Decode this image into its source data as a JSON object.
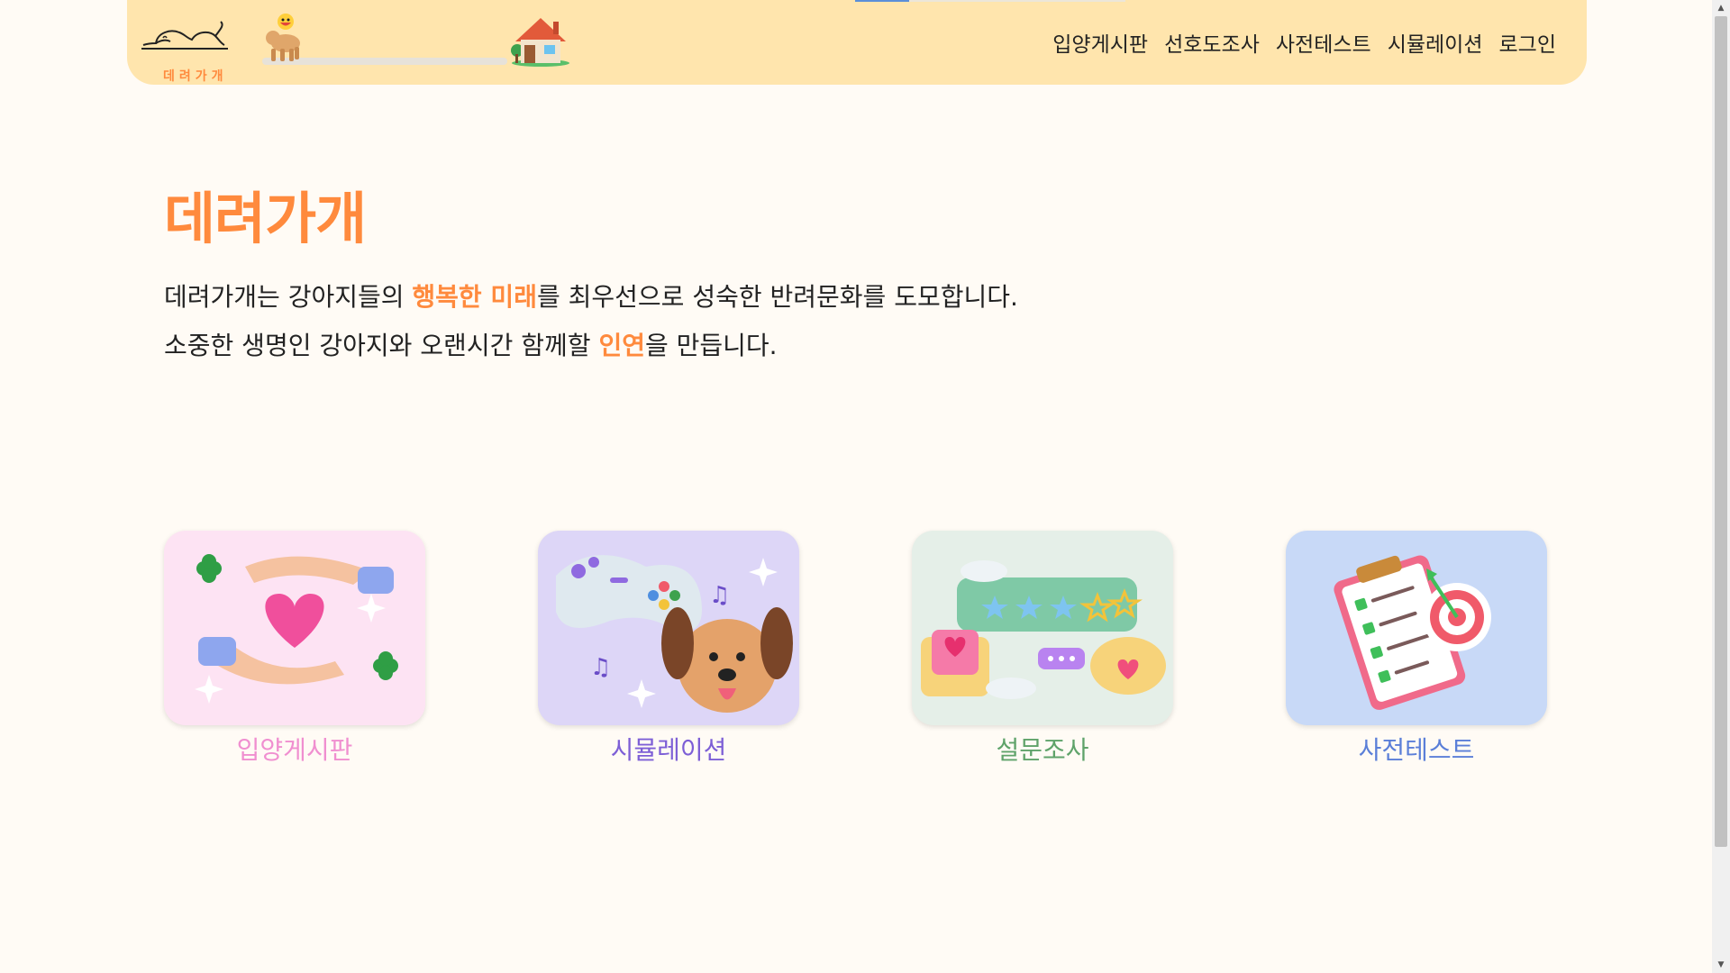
{
  "header": {
    "logo_text": "데려가개",
    "progress_fraction": 0.0,
    "nav": [
      "입양게시판",
      "선호도조사",
      "사전테스트",
      "시뮬레이션",
      "로그인"
    ]
  },
  "main": {
    "title": "데려가개",
    "line1": {
      "before": "데려가개는 강아지들의 ",
      "highlight": "행복한 미래",
      "after": "를 최우선으로 성숙한 반려문화를 도모합니다."
    },
    "line2": {
      "before": "소중한 생명인 강아지와 오랜시간 함께할 ",
      "highlight": "인연",
      "after": "을 만듭니다."
    }
  },
  "cards": [
    {
      "label": "입양게시판",
      "color": "#f08fd0",
      "bg": "#fde3f3"
    },
    {
      "label": "시뮬레이션",
      "color": "#7d5fd6",
      "bg": "#ddd6f7"
    },
    {
      "label": "설문조사",
      "color": "#5fa36a",
      "bg": "#e5efe8"
    },
    {
      "label": "사전테스트",
      "color": "#5b7fd8",
      "bg": "#c8d9f7"
    }
  ],
  "colors": {
    "accent": "#ff8a3d",
    "header_bg": "#ffe5ad",
    "page_bg": "#fffbf5"
  }
}
